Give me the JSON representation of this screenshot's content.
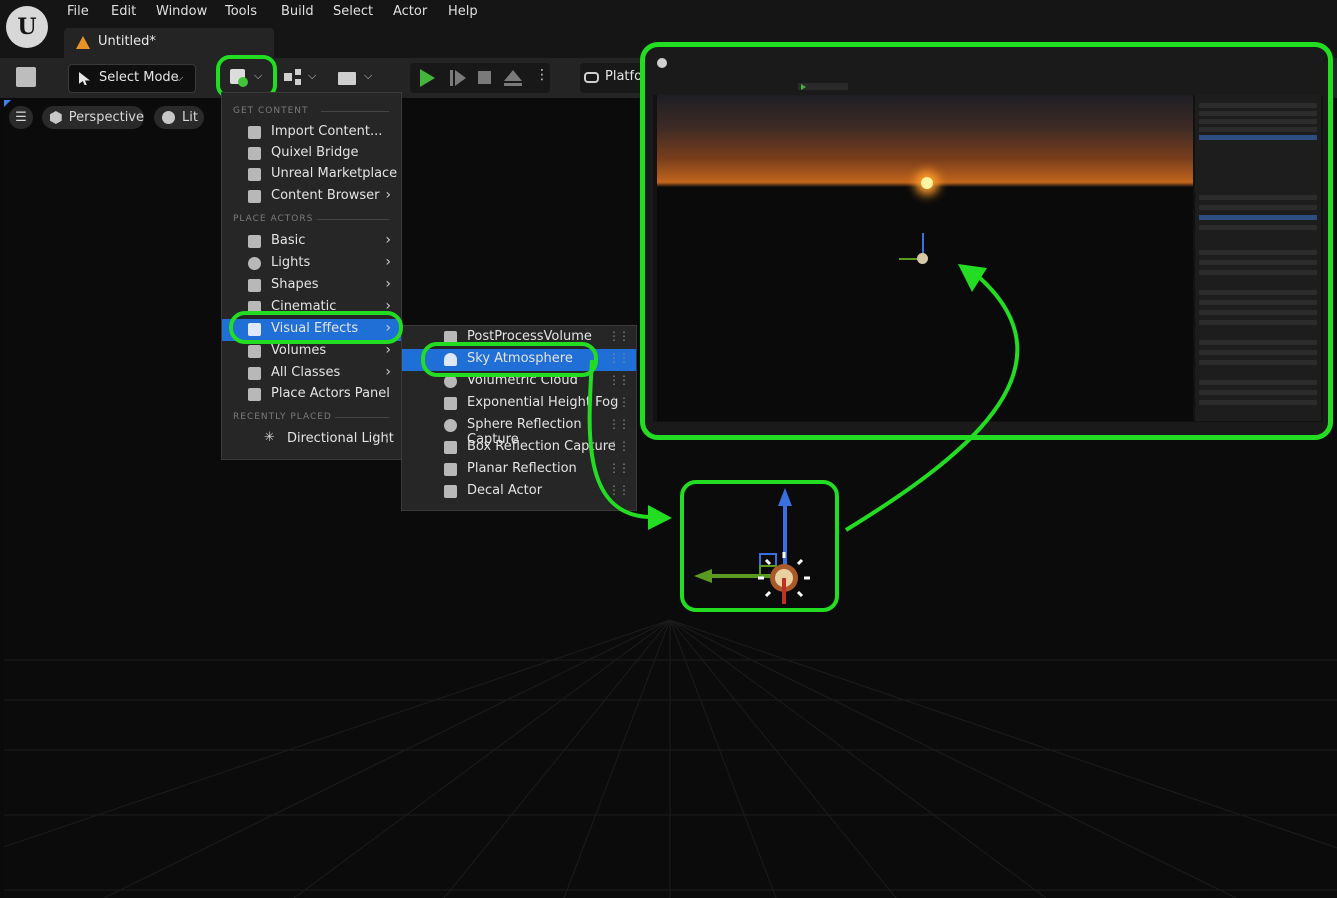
{
  "app": {
    "logo_letter": "U",
    "menu": [
      "File",
      "Edit",
      "Window",
      "Tools",
      "Build",
      "Select",
      "Actor",
      "Help"
    ],
    "tab_title": "Untitled*"
  },
  "toolbar": {
    "select_mode": "Select Mode",
    "platforms": "Platfo"
  },
  "viewport": {
    "perspective": "Perspective",
    "lit": "Lit"
  },
  "add_menu": {
    "section_get_content": "GET CONTENT",
    "import_content": "Import Content...",
    "quixel_bridge": "Quixel Bridge",
    "unreal_marketplace": "Unreal Marketplace",
    "content_browser": "Content Browser",
    "section_place_actors": "PLACE ACTORS",
    "basic": "Basic",
    "lights": "Lights",
    "shapes": "Shapes",
    "cinematic": "Cinematic",
    "visual_effects": "Visual Effects",
    "volumes": "Volumes",
    "all_classes": "All Classes",
    "place_actors_panel": "Place Actors Panel",
    "section_recently_placed": "RECENTLY PLACED",
    "directional_light": "Directional Light"
  },
  "vfx_submenu": {
    "items": [
      "PostProcessVolume",
      "Sky Atmosphere",
      "Volumetric Cloud",
      "Exponential Height Fog",
      "Sphere Reflection Capture",
      "Box Reflection Capture",
      "Planar Reflection",
      "Decal Actor"
    ]
  },
  "colors": {
    "highlight": "#22dd22",
    "selection": "#1f6fd6",
    "play": "#42b53a"
  }
}
